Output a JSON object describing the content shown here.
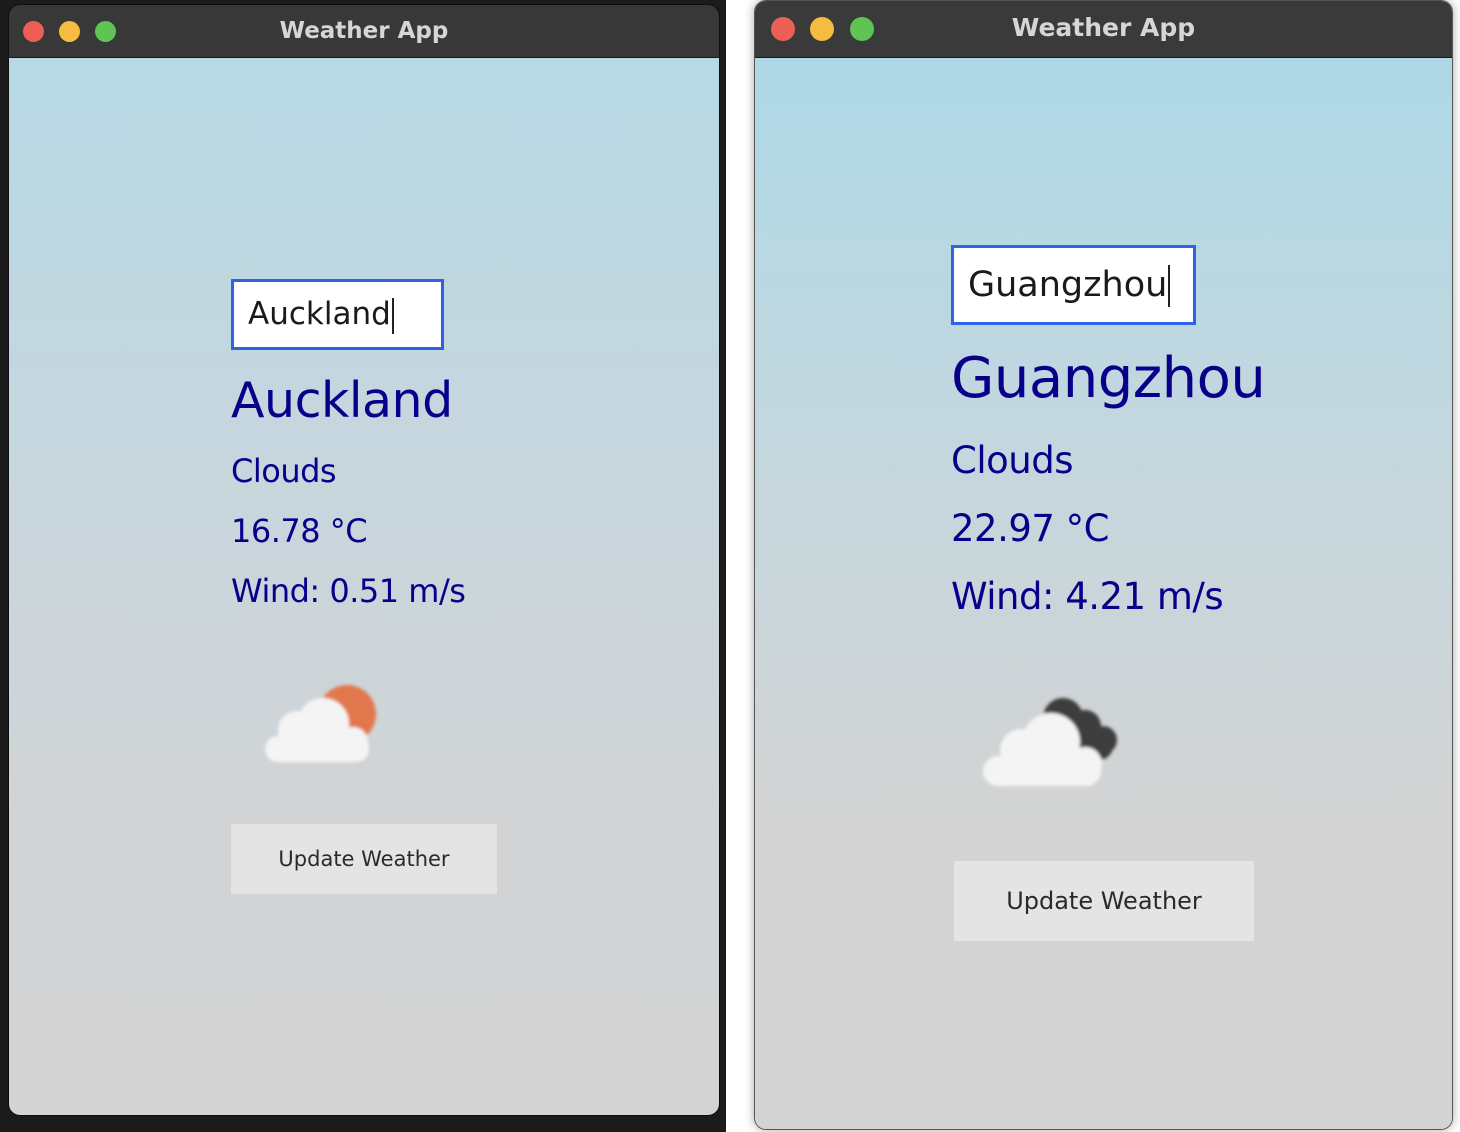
{
  "colors": {
    "close": "#ec5f55",
    "minimize": "#f4bd41",
    "zoom": "#60c454",
    "text": "#08008b",
    "input_border": "#2d63e6",
    "sun": "#e2774e",
    "dark_cloud": "#3c3c3c"
  },
  "windows": [
    {
      "title": "Weather App",
      "input_value": "Auckland",
      "city": "Auckland",
      "description": "Clouds",
      "temperature": "16.78 °C",
      "wind": "Wind: 0.51 m/s",
      "icon": "partly-cloudy-sun-icon",
      "button_label": "Update Weather"
    },
    {
      "title": "Weather App",
      "input_value": "Guangzhou",
      "city": "Guangzhou",
      "description": "Clouds",
      "temperature": "22.97 °C",
      "wind": "Wind: 4.21 m/s",
      "icon": "broken-clouds-icon",
      "button_label": "Update Weather"
    }
  ]
}
